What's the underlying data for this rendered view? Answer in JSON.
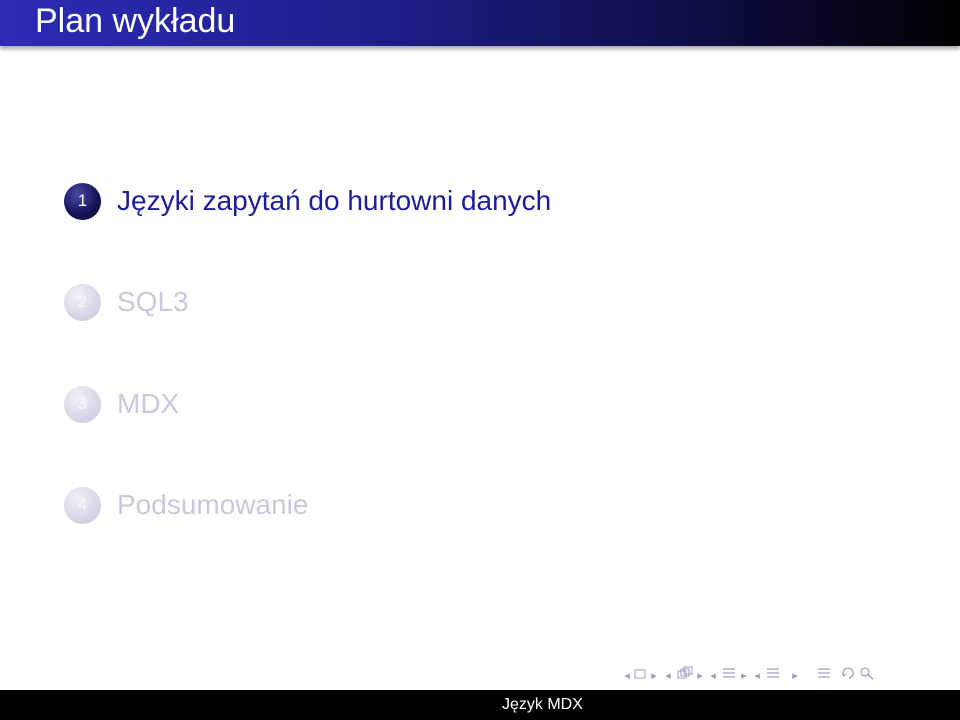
{
  "slide": {
    "title": "Plan wykładu",
    "footer": "Język MDX"
  },
  "toc": {
    "items": [
      {
        "number": "1",
        "label": "Języki zapytań do hurtowni danych",
        "active": true
      },
      {
        "number": "2",
        "label": "SQL3",
        "active": false
      },
      {
        "number": "3",
        "label": "MDX",
        "active": false
      },
      {
        "number": "4",
        "label": "Podsumowanie",
        "active": false
      }
    ]
  },
  "colors": {
    "title_gradient_start": "#2b2bb5",
    "title_gradient_end": "#000000",
    "active_text": "#1d1d9c",
    "inactive_text": "#c9c9dd",
    "footer_background": "#000000",
    "nav_icons": "#9c9cc4"
  },
  "nav": {
    "icons": [
      "frame-back-icon",
      "frame-icon",
      "frame-forward-icon",
      "subsection-back-icon",
      "subsection-icon",
      "subsection-forward-icon",
      "section-back-icon",
      "section-icon",
      "section-forward-icon",
      "appendix-icon",
      "search-icon",
      "zoom-icon"
    ]
  }
}
